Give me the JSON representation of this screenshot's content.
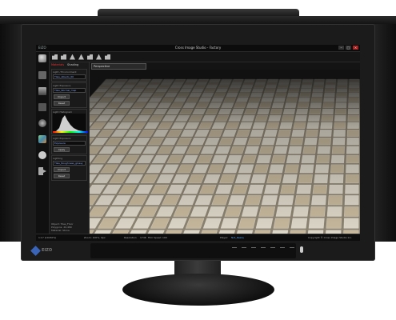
{
  "window": {
    "logo": "EIZO",
    "title": "Cross Image Studio - Factory",
    "minimize": "–",
    "maximize": "□",
    "close": "×"
  },
  "toolbar": {
    "icons": [
      "open-icon",
      "save-icon",
      "chart-icon",
      "export-icon",
      "print-icon",
      "settings-icon",
      "exit-icon"
    ]
  },
  "left_tools": {
    "icons": [
      "sphere-icon",
      "tool-icon",
      "layers-icon",
      "palette-icon",
      "lens-icon",
      "photo-icon",
      "settings-icon",
      "exit-icon"
    ]
  },
  "panel": {
    "tabs": [
      "Materials",
      "Shading"
    ],
    "section1_label": "Light / Environment",
    "field1": "Tiles_Albedo_00",
    "section2_label": "Light Exposure",
    "field2": "Tiles_Normal_map",
    "btn_import": "Import",
    "btn_reset": "Reset",
    "histogram_label": "Light Histogram",
    "section3_label": "Light Exposure",
    "field3": "Exposure",
    "btn_apply": "Apply",
    "section4_label": "Lighting",
    "field4": "Tiles_Roughness_glossy",
    "btn_import2": "Import",
    "btn_reset2": "Reset",
    "info_lines": [
      "Object: Tiles_Floor",
      "Polygons: 20,480",
      "Material: Stone"
    ]
  },
  "viewport": {
    "dropdown_value": "Perspective"
  },
  "statusbar": {
    "left": "1:17 (10x50%)",
    "mid1": "Zoom: 100%, 0px",
    "mid2": "Resolution",
    "mid3": "1746",
    "mid4": "Film Speed",
    "mid5": "100",
    "ready_label": "Player: ",
    "ready_value": "Not_Ready",
    "right": "Copyright © Cross Image Studio Inc."
  },
  "monitor": {
    "brand": "EIZO",
    "brand_color": "#3a64b8",
    "controls": [
      "Input",
      "Mode",
      "Color",
      "Brightness",
      "Auto",
      "Enter",
      "Menu",
      "Power"
    ]
  },
  "colors": {
    "tile_light": "#dcd6c8",
    "tile_dark": "#c6b89c",
    "grout": "#8c8372",
    "accent_tab": "#ee3333",
    "status_link": "#55aaff"
  }
}
